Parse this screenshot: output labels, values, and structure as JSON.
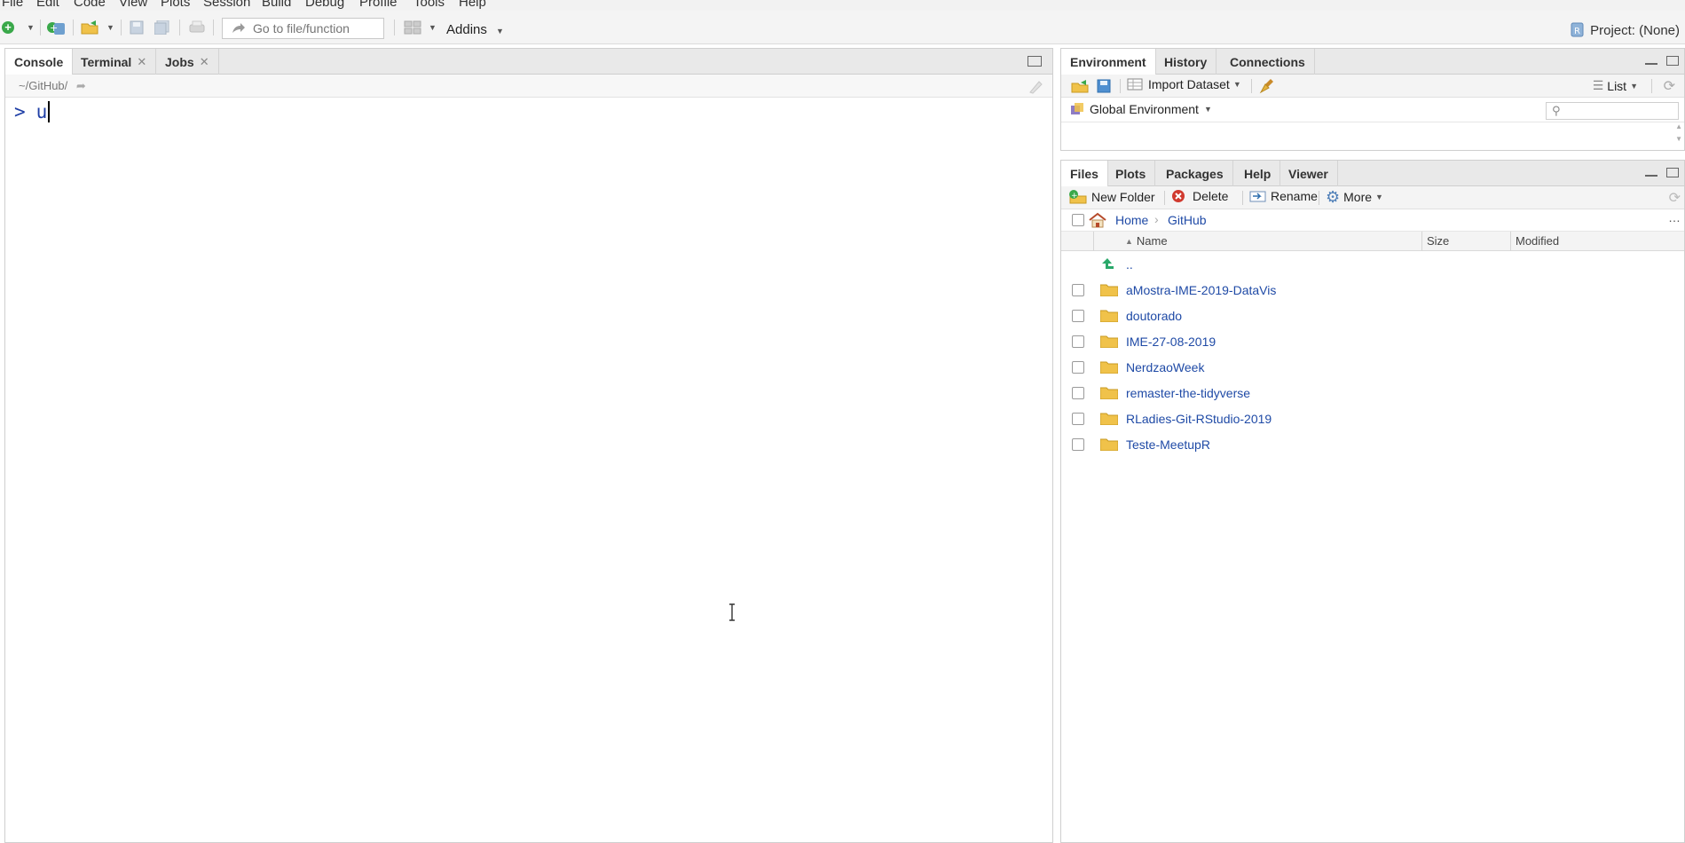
{
  "menu": [
    "File",
    "Edit",
    "Code",
    "View",
    "Plots",
    "Session",
    "Build",
    "Debug",
    "Profile",
    "Tools",
    "Help"
  ],
  "toolbar": {
    "goto_placeholder": "Go to file/function",
    "addins_label": "Addins",
    "project_label": "Project: (None)"
  },
  "console": {
    "tabs": [
      {
        "label": "Console"
      },
      {
        "label": "Terminal"
      },
      {
        "label": "Jobs"
      }
    ],
    "path": "~/GitHub/",
    "prompt": ">",
    "input": "u"
  },
  "environment": {
    "tabs": [
      "Environment",
      "History",
      "Connections"
    ],
    "import_label": "Import Dataset",
    "view_label": "List",
    "scope_label": "Global Environment"
  },
  "files": {
    "tabs": [
      "Files",
      "Plots",
      "Packages",
      "Help",
      "Viewer"
    ],
    "new_folder_label": "New Folder",
    "delete_label": "Delete",
    "rename_label": "Rename",
    "more_label": "More",
    "breadcrumb": [
      "Home",
      "GitHub"
    ],
    "columns": [
      "Name",
      "Size",
      "Modified"
    ],
    "up_label": "..",
    "items": [
      "aMostra-IME-2019-DataVis",
      "doutorado",
      "IME-27-08-2019",
      "NerdzaoWeek",
      "remaster-the-tidyverse",
      "RLadies-Git-RStudio-2019",
      "Teste-MeetupR"
    ]
  },
  "colors": {
    "accent_green": "#3aa84a",
    "link_blue": "#1f4aa6",
    "prompt_blue": "#1f3fa6",
    "folder_yellow": "#f0c24a"
  }
}
